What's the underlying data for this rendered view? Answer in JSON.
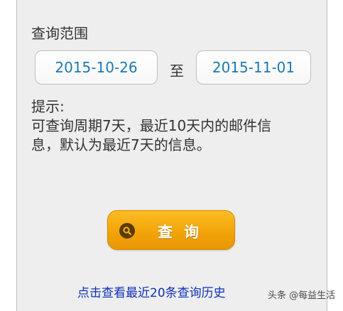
{
  "query": {
    "range_label": "查询范围",
    "start_date": "2015-10-26",
    "to_label": "至",
    "end_date": "2015-11-01",
    "hint_title": "提示:",
    "hint_line1": "可查询周期7天，最近10天内的邮件信",
    "hint_line2": "息，默认为最近7天的信息。",
    "button_label": "查询",
    "history_link": "点击查看最近20条查询历史"
  },
  "watermark": "头条 @每益生活",
  "colors": {
    "panel_bg": "#eeeeee",
    "date_text": "#1a7ab0",
    "button": "#f2a408",
    "link": "#1030b8"
  },
  "icons": {
    "button_icon": "search-icon"
  }
}
